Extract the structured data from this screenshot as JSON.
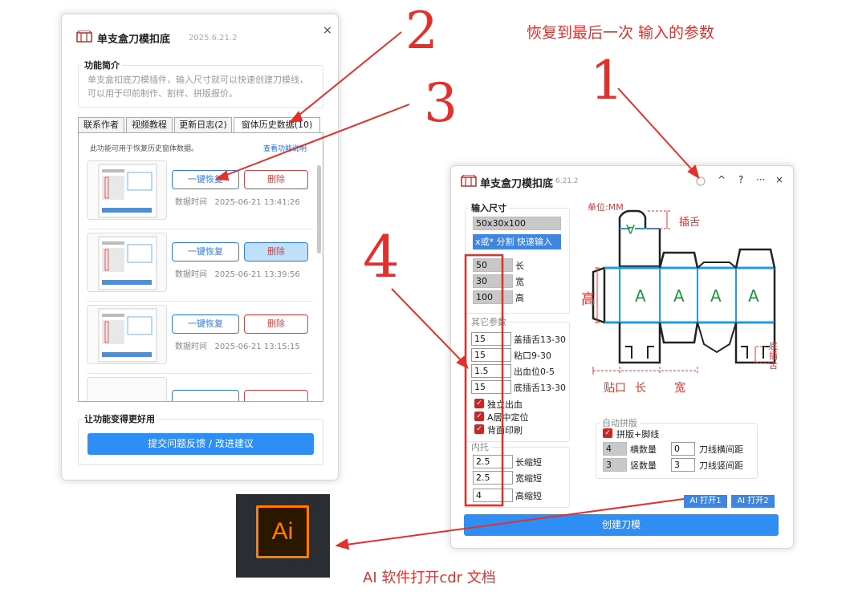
{
  "left_window": {
    "title": "单支盒刀模扣底",
    "version": "2025.6.21.2",
    "close": "×",
    "intro_legend": "功能简介",
    "intro_text": "单支盒扣底刀模插件，输入尺寸就可以快速创建刀模线，可以用于印前制作、割样、拼版报价。",
    "tabs": [
      {
        "label": "联系作者"
      },
      {
        "label": "视频教程"
      },
      {
        "label": "更新日志(2)"
      },
      {
        "label": "窗体历史数据(10)"
      }
    ],
    "panel_tip": "此功能可用于恢复历史窗体数据。",
    "panel_link": "查看功能说明",
    "records": [
      {
        "restore": "一键恢复",
        "delete": "删除",
        "time_label": "数据时间",
        "time": "2025-06-21 13:41:26"
      },
      {
        "restore": "一键恢复",
        "delete": "删除",
        "time_label": "数据时间",
        "time": "2025-06-21 13:39:56"
      },
      {
        "restore": "一键恢复",
        "delete": "删除",
        "time_label": "数据时间",
        "time": "2025-06-21 13:15:15"
      }
    ],
    "feedback_legend": "让功能变得更好用",
    "feedback_button": "提交问题反馈 / 改进建议"
  },
  "right_window": {
    "title": "单支盒刀模扣底",
    "version": "6.21.2",
    "toolbar": {
      "minimize": "^",
      "help": "?",
      "more": "···",
      "close": "×"
    },
    "input_legend": "输入尺寸",
    "quick_value": "50x30x100",
    "quick_hint": "x或* 分割 快速输入",
    "dims": [
      {
        "value": "50",
        "label": "长"
      },
      {
        "value": "30",
        "label": "宽"
      },
      {
        "value": "100",
        "label": "高"
      }
    ],
    "other_legend": "其它参数",
    "params": [
      {
        "value": "15",
        "label": "盖插舌13-30"
      },
      {
        "value": "15",
        "label": "粘口9-30"
      },
      {
        "value": "1.5",
        "label": "出血位0-5"
      },
      {
        "value": "15",
        "label": "底插舌13-30"
      }
    ],
    "checks": [
      {
        "label": "独立出血"
      },
      {
        "label": "A居中定位"
      },
      {
        "label": "背面印刷"
      }
    ],
    "inner_legend": "内托",
    "inner": [
      {
        "value": "2.5",
        "label": "长缩短"
      },
      {
        "value": "2.5",
        "label": "宽缩短"
      },
      {
        "value": "4",
        "label": "高缩短"
      }
    ],
    "unit": "单位:MM",
    "diagram": {
      "tuck": "插舌",
      "height": "高",
      "bottom_tuck": [
        "底",
        "插",
        "舌"
      ],
      "glue": "贴口",
      "length": "长",
      "width": "宽",
      "face": "A"
    },
    "layout_legend": "自动拼版",
    "layout_check": "拼版+脚线",
    "layout": [
      {
        "count": "4",
        "count_label": "横数量",
        "gap": "0",
        "gap_label": "刀线横间距"
      },
      {
        "count": "3",
        "count_label": "竖数量",
        "gap": "3",
        "gap_label": "刀线竖间距"
      }
    ],
    "ai_open": [
      "AI 打开1",
      "AI 打开2"
    ],
    "create_button": "创建刀模"
  },
  "annotations": {
    "n1": "1",
    "n2": "2",
    "n3": "3",
    "n4": "4",
    "restore_note": "恢复到最后一次  输入的参数",
    "ai_note": "AI  软件打开cdr 文档",
    "ai_logo": "Ai"
  },
  "colors": {
    "accent": "#2f8ef3",
    "annotation": "#e2312d",
    "diagram_blue": "#1e9fdc",
    "diagram_green": "#1a9a3a"
  }
}
